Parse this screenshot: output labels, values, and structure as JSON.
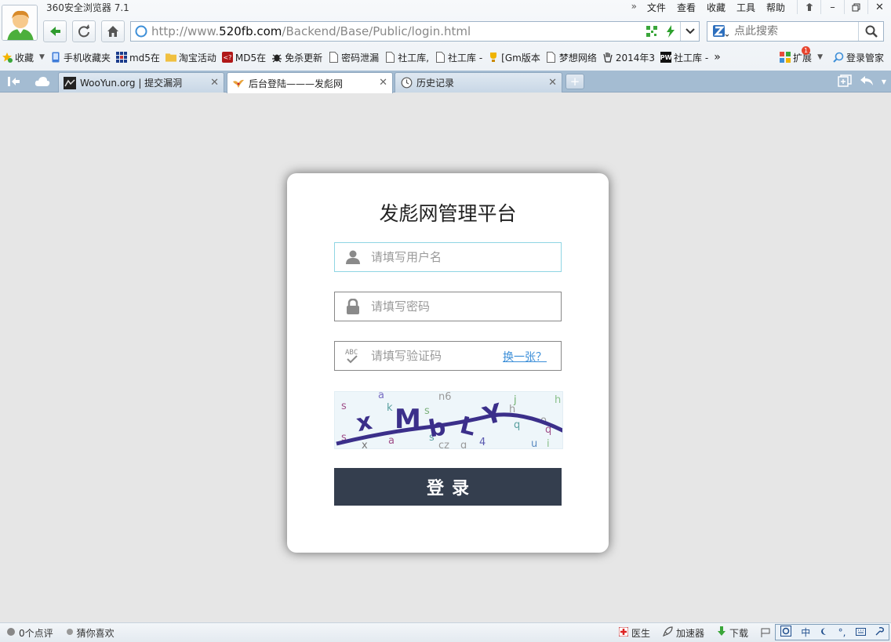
{
  "browser": {
    "app_title": "360安全浏览器 7.1",
    "menu": {
      "more": "»",
      "file": "文件",
      "view": "查看",
      "favorites": "收藏",
      "tools": "工具",
      "help": "帮助"
    },
    "url": {
      "prefix": "http://www.",
      "domain": "520fb.com",
      "path": "/Backend/Base/Public/login.html"
    },
    "search_placeholder": "点此搜索"
  },
  "bookmarks": {
    "items": [
      {
        "label": "收藏",
        "icon": "star-add-icon"
      },
      {
        "label": "手机收藏夹",
        "icon": "phone-icon"
      },
      {
        "label": "md5在",
        "icon": "grid-icon"
      },
      {
        "label": "淘宝活动",
        "icon": "folder-icon"
      },
      {
        "label": "MD5在",
        "icon": "md5-icon"
      },
      {
        "label": "免杀更新",
        "icon": "bug-icon"
      },
      {
        "label": "密码泄漏",
        "icon": "page-icon"
      },
      {
        "label": "社工库,",
        "icon": "page-icon"
      },
      {
        "label": "社工库 -",
        "icon": "page-icon"
      },
      {
        "label": "[Gm版本",
        "icon": "trophy-icon"
      },
      {
        "label": "梦想网络",
        "icon": "page-icon"
      },
      {
        "label": "2014年3",
        "icon": "hand-icon"
      },
      {
        "label": "社工库 -",
        "icon": "pw-icon"
      }
    ],
    "more": "»",
    "extensions": "扩展",
    "extensions_badge": "1",
    "login_manager": "登录管家"
  },
  "tabs": [
    {
      "title": "WooYun.org | 提交漏洞",
      "close": "✕"
    },
    {
      "title": "后台登陆———发彪网",
      "close": "✕"
    },
    {
      "title": "历史记录",
      "close": "✕"
    }
  ],
  "login": {
    "title": "发彪网管理平台",
    "username_placeholder": "请填写用户名",
    "password_placeholder": "请填写密码",
    "captcha_placeholder": "请填写验证码",
    "refresh_captcha": "换一张？",
    "submit": "登录",
    "captcha_text": "xMbLY"
  },
  "statusbar": {
    "comments": "0个点评",
    "guess": "猜你喜欢",
    "doctor": "医生",
    "accelerator": "加速器",
    "download": "下载"
  },
  "ime": {
    "lang": "中"
  }
}
